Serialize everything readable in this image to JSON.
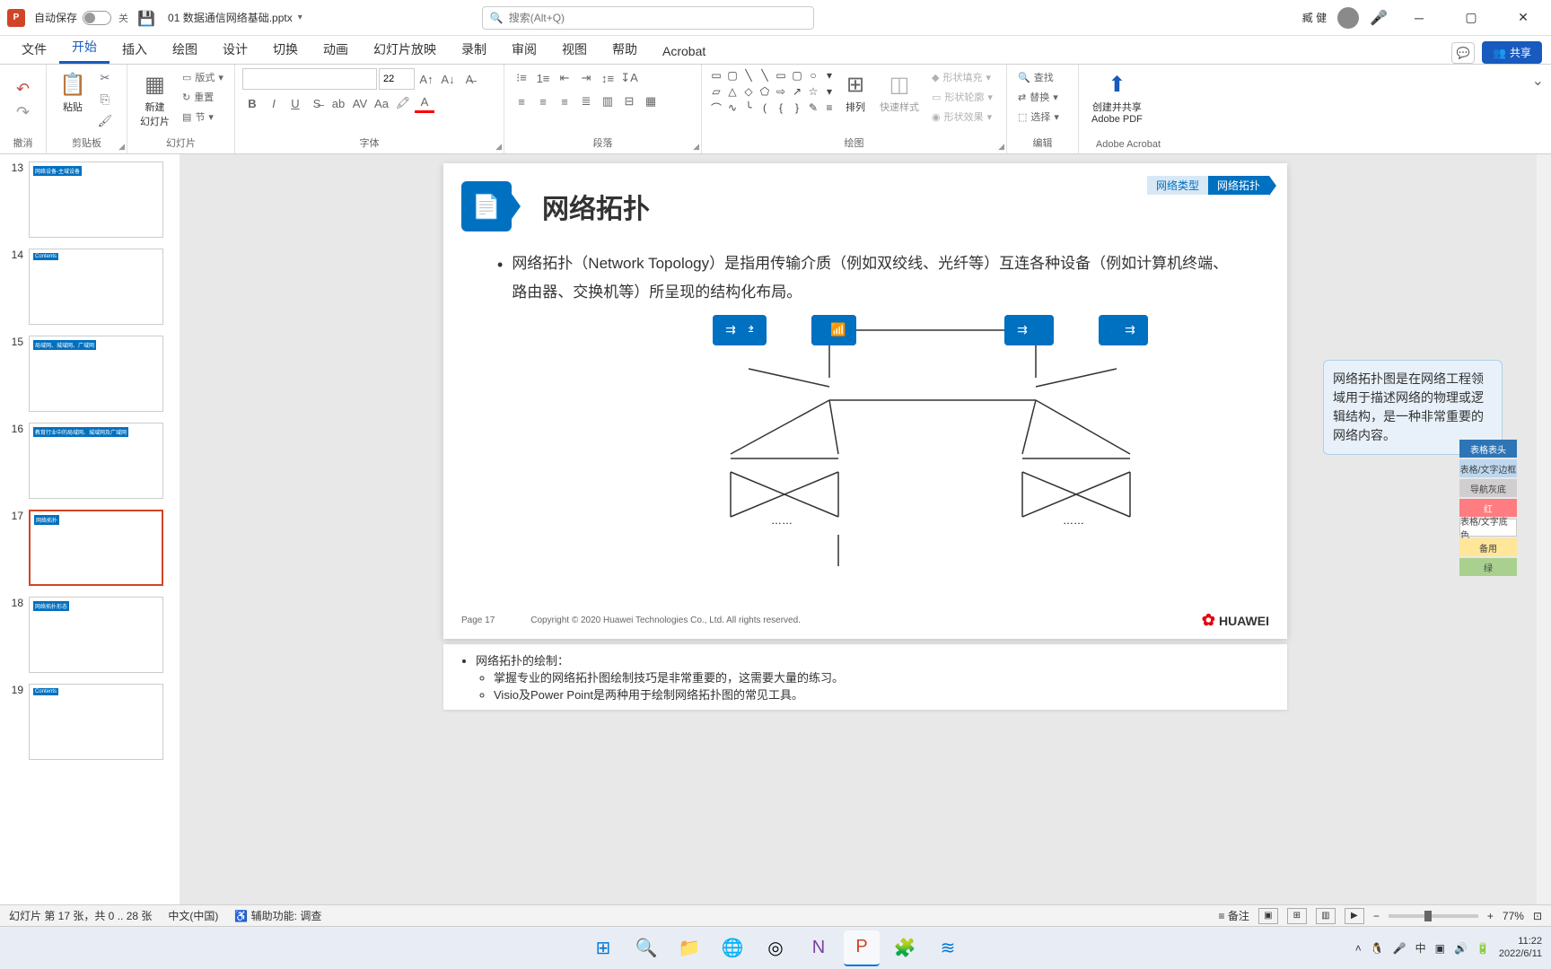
{
  "titlebar": {
    "autosave_label": "自动保存",
    "toggle_state": "关",
    "filename": "01 数据通信网络基础.pptx",
    "search_placeholder": "搜索(Alt+Q)",
    "username": "臧 健"
  },
  "ribbon_tabs": {
    "items": [
      "文件",
      "开始",
      "插入",
      "绘图",
      "设计",
      "切换",
      "动画",
      "幻灯片放映",
      "录制",
      "审阅",
      "视图",
      "帮助",
      "Acrobat"
    ],
    "active_index": 1,
    "share_label": "共享"
  },
  "ribbon": {
    "groups": {
      "undo": "撤消",
      "clipboard": "剪贴板",
      "paste": "粘贴",
      "slides": "幻灯片",
      "new_slide": "新建\n幻灯片",
      "layout": "版式",
      "reset": "重置",
      "section": "节",
      "font": "字体",
      "font_size": "22",
      "paragraph": "段落",
      "drawing": "绘图",
      "arrange": "排列",
      "quick_styles": "快速样式",
      "shape_fill": "形状填充",
      "shape_outline": "形状轮廓",
      "shape_effects": "形状效果",
      "editing": "编辑",
      "find": "查找",
      "replace": "替换",
      "select": "选择",
      "acrobat": "Adobe Acrobat",
      "create_share_pdf": "创建并共享\nAdobe PDF"
    }
  },
  "thumbnails": [
    {
      "num": 13,
      "label": "网络设备-主域设备"
    },
    {
      "num": 14,
      "label": "Contents"
    },
    {
      "num": 15,
      "label": "局域网、城域网、广域网"
    },
    {
      "num": 16,
      "label": "教育行业中的局域网、城域网及广域网"
    },
    {
      "num": 17,
      "label": "网络拓扑"
    },
    {
      "num": 18,
      "label": "网络拓扑形态"
    },
    {
      "num": 19,
      "label": "Contents"
    }
  ],
  "active_thumb": 17,
  "slide": {
    "tag1": "网络类型",
    "tag2": "网络拓扑",
    "title": "网络拓扑",
    "bullet": "网络拓扑（Network Topology）是指用传输介质（例如双绞线、光纤等）互连各种设备（例如计算机终端、路由器、交换机等）所呈现的结构化布局。",
    "callout": "网络拓扑图是在网络工程领域用于描述网络的物理或逻辑结构，是一种非常重要的网络内容。",
    "dots": "……",
    "page_label": "Page 17",
    "copyright": "Copyright © 2020 Huawei Technologies Co., Ltd. All rights reserved.",
    "logo_text": "HUAWEI"
  },
  "notes": {
    "line1": "网络拓扑的绘制：",
    "line2": "掌握专业的网络拓扑图绘制技巧是非常重要的，这需要大量的练习。",
    "line3": "Visio及Power Point是两种用于绘制网络拓扑图的常见工具。"
  },
  "palette": [
    {
      "label": "表格表头",
      "bg": "#2e75b6",
      "fg": "#fff"
    },
    {
      "label": "表格/文字边框",
      "bg": "#bdd7ee",
      "fg": "#333"
    },
    {
      "label": "导航灰底",
      "bg": "#d0cece",
      "fg": "#333"
    },
    {
      "label": "红",
      "bg": "#ff7c80",
      "fg": "#fff"
    },
    {
      "label": "表格/文字底色",
      "bg": "#ffffff",
      "fg": "#333"
    },
    {
      "label": "备用",
      "bg": "#ffe699",
      "fg": "#333"
    },
    {
      "label": "绿",
      "bg": "#a9d08e",
      "fg": "#333"
    }
  ],
  "statusbar": {
    "slide_info": "幻灯片 第 17 张，共 0 .. 28 张",
    "language": "中文(中国)",
    "accessibility": "辅助功能: 调查",
    "notes_btn": "备注",
    "zoom": "77%"
  },
  "taskbar": {
    "time": "11:22",
    "date": "2022/6/11"
  }
}
